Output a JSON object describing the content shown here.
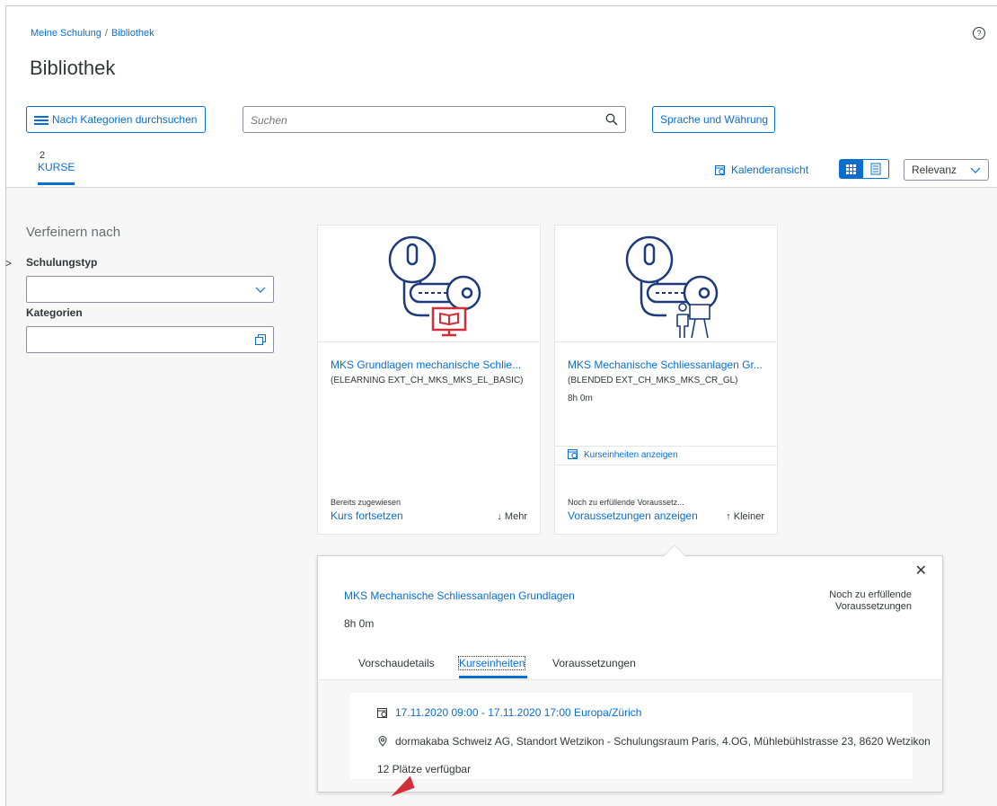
{
  "header": {
    "breadcrumb": [
      "Meine Schulung",
      "Bibliothek"
    ],
    "breadcrumb_sep": "/",
    "title": "Bibliothek",
    "help_icon": "question-circle-icon",
    "browse_categories": "Nach Kategorien durchsuchen",
    "search_placeholder": "Suchen",
    "language_currency": "Sprache und Währung",
    "result_count": "2",
    "tab_courses": "KURSE",
    "calendar_view": "Kalenderansicht",
    "sort_value": "Relevanz"
  },
  "filters": {
    "heading": "Verfeinern nach",
    "training_type_label": "Schulungstyp",
    "categories_label": "Kategorien"
  },
  "cards": [
    {
      "title": "MKS Grundlagen mechanische Schlie...",
      "code": "(ELEARNING EXT_CH_MKS_MKS_EL_BASIC)",
      "status": "Bereits zugewiesen",
      "action": "Kurs fortsetzen",
      "more": "↓ Mehr",
      "icon": "key-elearning-icon"
    },
    {
      "title": "MKS Mechanische Schliessanlagen Gr...",
      "code": "(BLENDED EXT_CH_MKS_MKS_CR_GL)",
      "duration": "8h 0m",
      "sessions_link": "Kurseinheiten anzeigen",
      "status": "Noch zu erfüllende Voraussetz...",
      "action": "Voraussetzungen anzeigen",
      "more": "↑ Kleiner",
      "icon": "key-classroom-icon"
    }
  ],
  "popup": {
    "title": "MKS Mechanische Schliessanlagen Grundlagen",
    "status_line1": "Noch zu erfüllende",
    "status_line2": "Voraussetzungen",
    "duration": "8h 0m",
    "tabs": [
      "Vorschaudetails",
      "Kurseinheiten",
      "Voraussetzungen"
    ],
    "active_tab": "Kurseinheiten",
    "session": {
      "date": "17.11.2020 09:00 - 17.11.2020 17:00 Europa/Zürich",
      "location": "dormakaba Schweiz AG, Standort Wetzikon - Schulungsraum Paris, 4.OG, Mühlebühlstrasse 23, 8620 Wetzikon",
      "seats": "12 Plätze verfügbar"
    }
  },
  "colors": {
    "accent": "#0a6ed1",
    "text": "#32363a",
    "icon_stroke": "#1d3a7a",
    "icon_red": "#d12e3a"
  }
}
